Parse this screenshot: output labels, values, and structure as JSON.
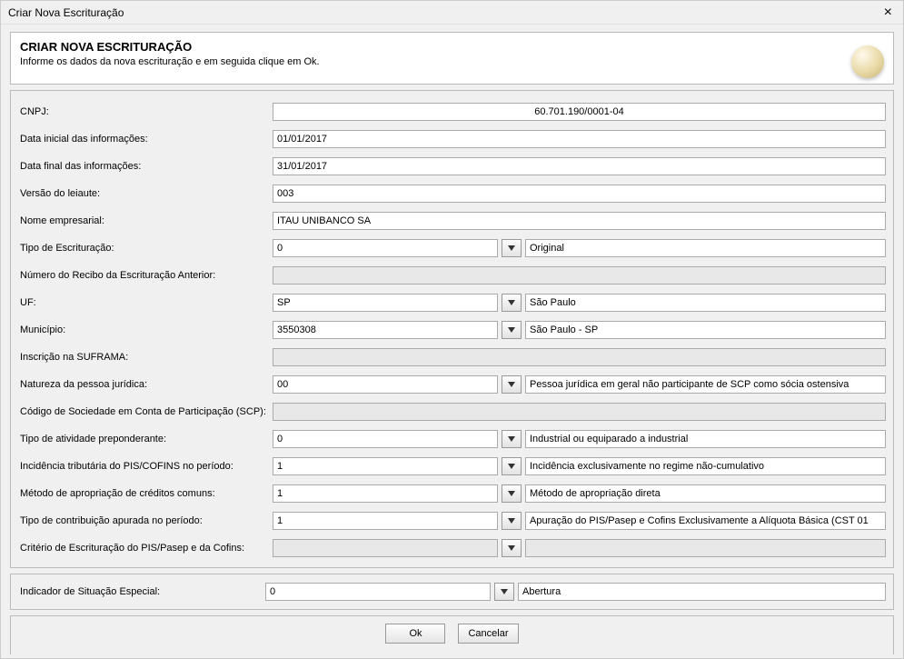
{
  "window": {
    "title": "Criar Nova Escrituração"
  },
  "header": {
    "title": "CRIAR NOVA ESCRITURAÇÃO",
    "subtitle": "Informe os dados da nova escrituração e em seguida clique em Ok."
  },
  "labels": {
    "cnpj": "CNPJ:",
    "data_inicial": "Data inicial das informações:",
    "data_final": "Data final das informações:",
    "versao": "Versão do leiaute:",
    "nome": "Nome empresarial:",
    "tipo_escrituracao": "Tipo de Escrituração:",
    "numero_recibo": "Número do Recibo da Escrituração Anterior:",
    "uf": "UF:",
    "municipio": "Município:",
    "suframa": "Inscrição na SUFRAMA:",
    "natureza": "Natureza da pessoa jurídica:",
    "scp": "Código de Sociedade em Conta de Participação (SCP):",
    "atividade": "Tipo de atividade preponderante:",
    "incidencia": "Incidência tributária do PIS/COFINS no período:",
    "metodo": "Método de apropriação de créditos comuns:",
    "tipo_contrib": "Tipo de contribuição apurada no período:",
    "criterio": "Critério de Escrituração do PIS/Pasep e da Cofins:",
    "situacao": "Indicador de Situação Especial:"
  },
  "fields": {
    "cnpj": "60.701.190/0001-04",
    "data_inicial": "01/01/2017",
    "data_final": "31/01/2017",
    "versao": "003",
    "nome": "ITAU UNIBANCO SA",
    "tipo_escrituracao": {
      "code": "0",
      "desc": "Original"
    },
    "numero_recibo": "",
    "uf": {
      "code": "SP",
      "desc": "São Paulo"
    },
    "municipio": {
      "code": "3550308",
      "desc": "São Paulo - SP"
    },
    "suframa": "",
    "natureza": {
      "code": "00",
      "desc": "Pessoa jurídica em geral não participante de SCP como sócia ostensiva"
    },
    "scp": "",
    "atividade": {
      "code": "0",
      "desc": "Industrial ou equiparado a industrial"
    },
    "incidencia": {
      "code": "1",
      "desc": "Incidência exclusivamente no regime não-cumulativo"
    },
    "metodo": {
      "code": "1",
      "desc": "Método de apropriação direta"
    },
    "tipo_contrib": {
      "code": "1",
      "desc": "Apuração do PIS/Pasep e Cofins Exclusivamente a Alíquota Básica (CST 01"
    },
    "criterio": {
      "code": "",
      "desc": ""
    },
    "situacao": {
      "code": "0",
      "desc": "Abertura"
    }
  },
  "buttons": {
    "ok": "Ok",
    "cancel": "Cancelar"
  }
}
